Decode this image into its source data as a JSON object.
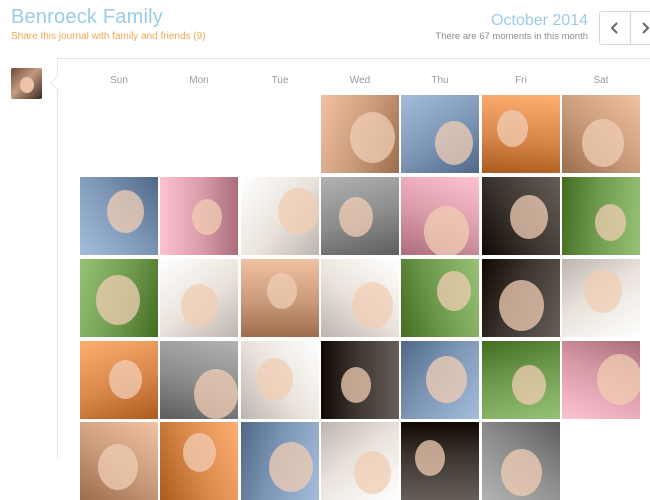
{
  "header": {
    "title": "Benroeck Family",
    "share_link": "Share this journal with family and friends (9)",
    "month": "October 2014",
    "moment_count": "There are 67 moments in this month"
  },
  "nav": {
    "prev_icon": "chevron-left-icon",
    "next_icon": "chevron-right-icon"
  },
  "weekdays": [
    "Sun",
    "Mon",
    "Tue",
    "Wed",
    "Thu",
    "Fri",
    "Sat"
  ],
  "photo_tones": {
    "warm": "#c89a7a",
    "cool": "#7d95b5",
    "gray": "#8a8a8a",
    "green": "#6f9a4e",
    "pink": "#d99aa8",
    "dark": "#3c3530",
    "light": "#e9e2da",
    "orange": "#d9874a"
  },
  "weeks": [
    [
      "",
      "",
      "",
      "warm",
      "cool",
      "orange",
      "warm"
    ],
    [
      "cool",
      "pink",
      "light",
      "gray",
      "pink",
      "dark",
      "green"
    ],
    [
      "green",
      "light",
      "warm",
      "light",
      "green",
      "dark",
      "light"
    ],
    [
      "orange",
      "gray",
      "light",
      "dark",
      "cool",
      "green",
      "pink"
    ],
    [
      "warm",
      "orange",
      "cool",
      "light",
      "dark",
      "gray",
      ""
    ]
  ]
}
